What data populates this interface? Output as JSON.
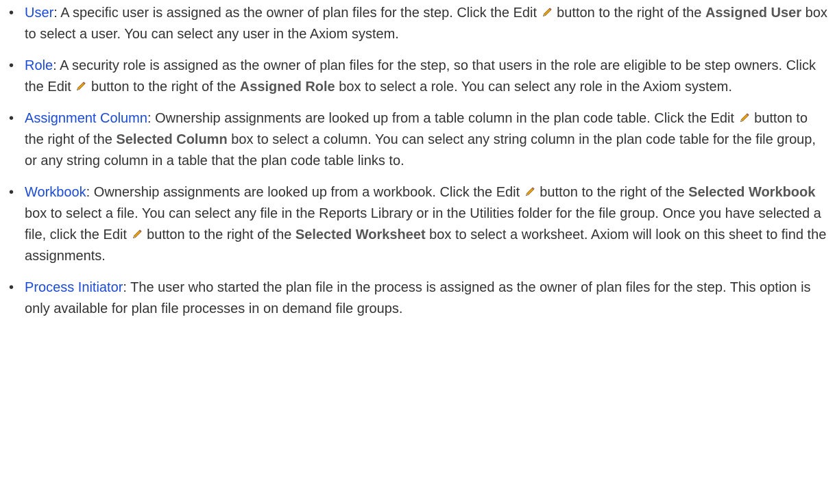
{
  "items": [
    {
      "term": "User",
      "parts": [
        {
          "t": "text",
          "v": ": A specific user is assigned as the owner of plan files for the step. Click the Edit "
        },
        {
          "t": "icon",
          "v": "pencil-icon"
        },
        {
          "t": "text",
          "v": " button to the right of the "
        },
        {
          "t": "bold",
          "v": "Assigned User"
        },
        {
          "t": "text",
          "v": " box to select a user. You can select any user in the Axiom system."
        }
      ]
    },
    {
      "term": "Role",
      "parts": [
        {
          "t": "text",
          "v": ": A security role is assigned as the owner of plan files for the step, so that users in the role are eligible to be step owners. Click the Edit "
        },
        {
          "t": "icon",
          "v": "pencil-icon"
        },
        {
          "t": "text",
          "v": " button to the right of the "
        },
        {
          "t": "bold",
          "v": "Assigned Role"
        },
        {
          "t": "text",
          "v": " box to select a role. You can select any role in the Axiom system."
        }
      ]
    },
    {
      "term": "Assignment Column",
      "parts": [
        {
          "t": "text",
          "v": ": Ownership assignments are looked up from a table column in the plan code table. Click the Edit "
        },
        {
          "t": "icon",
          "v": "pencil-icon"
        },
        {
          "t": "text",
          "v": " button to the right of the "
        },
        {
          "t": "bold",
          "v": "Selected Column"
        },
        {
          "t": "text",
          "v": " box to select a column. You can select any string column in the plan code table for the file group, or any string column in a table that the plan code table links to."
        }
      ]
    },
    {
      "term": "Workbook",
      "parts": [
        {
          "t": "text",
          "v": ": Ownership assignments are looked up from a workbook. Click the Edit "
        },
        {
          "t": "icon",
          "v": "pencil-icon"
        },
        {
          "t": "text",
          "v": " button to the right of the "
        },
        {
          "t": "bold",
          "v": "Selected Workbook"
        },
        {
          "t": "text",
          "v": " box to select a file. You can select any file in the Reports Library or in the Utilities folder for the file group. Once you have selected a file, click the Edit "
        },
        {
          "t": "icon",
          "v": "pencil-icon"
        },
        {
          "t": "text",
          "v": " button to the right of the "
        },
        {
          "t": "bold",
          "v": "Selected Worksheet"
        },
        {
          "t": "text",
          "v": " box to select a worksheet. Axiom will look on this sheet to find the assignments."
        }
      ]
    },
    {
      "term": "Process Initiator",
      "parts": [
        {
          "t": "text",
          "v": ": The user who started the plan file in the process is assigned as the owner of plan files for the step. This option is only available for plan file processes in on demand file groups."
        }
      ]
    }
  ],
  "colors": {
    "link": "#1b4bd6",
    "text": "#333333",
    "label": "#555555"
  }
}
